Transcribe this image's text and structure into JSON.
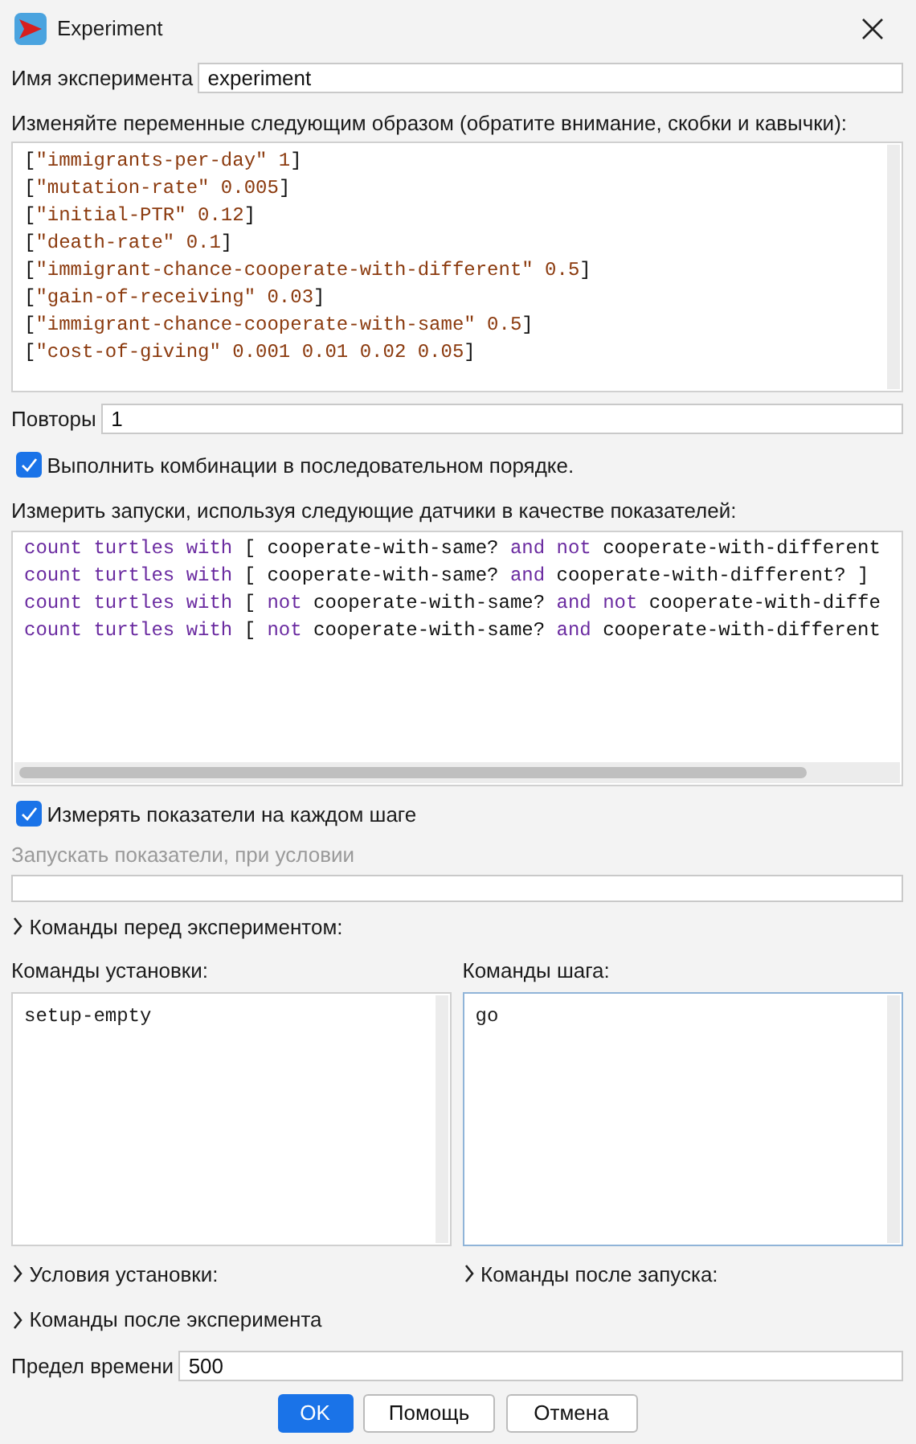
{
  "window": {
    "title": "Experiment"
  },
  "experiment_name": {
    "label": "Имя эксперимента",
    "value": "experiment"
  },
  "variables": {
    "label": "Изменяйте переменные следующим образом (обратите внимание, скобки и кавычки):",
    "lines": [
      [
        {
          "text": "[",
          "kind": "plain"
        },
        {
          "text": "\"immigrants-per-day\" 1",
          "kind": "literal"
        },
        {
          "text": "]",
          "kind": "plain"
        }
      ],
      [
        {
          "text": "[",
          "kind": "plain"
        },
        {
          "text": "\"mutation-rate\" 0.005",
          "kind": "literal"
        },
        {
          "text": "]",
          "kind": "plain"
        }
      ],
      [
        {
          "text": "[",
          "kind": "plain"
        },
        {
          "text": "\"initial-PTR\" 0.12",
          "kind": "literal"
        },
        {
          "text": "]",
          "kind": "plain"
        }
      ],
      [
        {
          "text": "[",
          "kind": "plain"
        },
        {
          "text": "\"death-rate\" 0.1",
          "kind": "literal"
        },
        {
          "text": "]",
          "kind": "plain"
        }
      ],
      [
        {
          "text": "[",
          "kind": "plain"
        },
        {
          "text": "\"immigrant-chance-cooperate-with-different\" 0.5",
          "kind": "literal"
        },
        {
          "text": "]",
          "kind": "plain"
        }
      ],
      [
        {
          "text": "[",
          "kind": "plain"
        },
        {
          "text": "\"gain-of-receiving\" 0.03",
          "kind": "literal"
        },
        {
          "text": "]",
          "kind": "plain"
        }
      ],
      [
        {
          "text": "[",
          "kind": "plain"
        },
        {
          "text": "\"immigrant-chance-cooperate-with-same\" 0.5",
          "kind": "literal"
        },
        {
          "text": "]",
          "kind": "plain"
        }
      ],
      [
        {
          "text": "[",
          "kind": "plain"
        },
        {
          "text": "\"cost-of-giving\" 0.001 0.01 0.02 0.05",
          "kind": "literal"
        },
        {
          "text": "]",
          "kind": "plain"
        }
      ]
    ]
  },
  "repetitions": {
    "label": "Повторы",
    "value": "1"
  },
  "sequential": {
    "label": "Выполнить комбинации в последовательном порядке.",
    "checked": true
  },
  "reporters": {
    "label": "Измерить запуски, используя следующие датчики в качестве показателей:",
    "lines": [
      [
        {
          "text": "count turtles with",
          "kind": "keyword"
        },
        {
          "text": " [ cooperate-with-same? ",
          "kind": "plain"
        },
        {
          "text": "and not",
          "kind": "keyword"
        },
        {
          "text": " cooperate-with-different",
          "kind": "plain"
        }
      ],
      [
        {
          "text": "count turtles with",
          "kind": "keyword"
        },
        {
          "text": " [ cooperate-with-same? ",
          "kind": "plain"
        },
        {
          "text": "and",
          "kind": "keyword"
        },
        {
          "text": " cooperate-with-different? ]",
          "kind": "plain"
        }
      ],
      [
        {
          "text": "count turtles with",
          "kind": "keyword"
        },
        {
          "text": " [ ",
          "kind": "plain"
        },
        {
          "text": "not",
          "kind": "keyword"
        },
        {
          "text": " cooperate-with-same? ",
          "kind": "plain"
        },
        {
          "text": "and not",
          "kind": "keyword"
        },
        {
          "text": " cooperate-with-diffe",
          "kind": "plain"
        }
      ],
      [
        {
          "text": "count turtles with",
          "kind": "keyword"
        },
        {
          "text": " [ ",
          "kind": "plain"
        },
        {
          "text": "not",
          "kind": "keyword"
        },
        {
          "text": " cooperate-with-same? ",
          "kind": "plain"
        },
        {
          "text": "and",
          "kind": "keyword"
        },
        {
          "text": " cooperate-with-different",
          "kind": "plain"
        }
      ]
    ]
  },
  "every_step": {
    "label": "Измерять показатели на каждом шаге",
    "checked": true
  },
  "run_condition": {
    "label": "Запускать показатели, при условии",
    "disabled": true
  },
  "pre_experiment": {
    "label": "Команды перед экспериментом:",
    "expanded": false
  },
  "setup": {
    "label": "Команды установки:",
    "value": "setup-empty",
    "focused": false
  },
  "go": {
    "label": "Команды шага:",
    "value": "go",
    "focused": true
  },
  "setup_conditions": {
    "label": "Условия установки:",
    "expanded": false
  },
  "post_run": {
    "label": "Команды после запуска:",
    "expanded": false
  },
  "post_experiment": {
    "label": "Команды после эксперимента",
    "expanded": false
  },
  "time_limit": {
    "label": "Предел времени",
    "value": "500"
  },
  "buttons": [
    {
      "label": "OK",
      "kind": "primary"
    },
    {
      "label": "Помощь",
      "kind": "default"
    },
    {
      "label": "Отмена",
      "kind": "default"
    }
  ]
}
